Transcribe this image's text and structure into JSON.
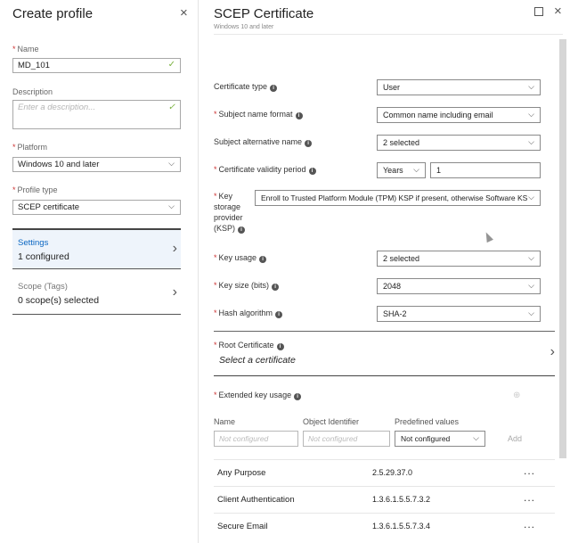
{
  "left_blade": {
    "title": "Create profile",
    "close_glyph": "×",
    "name": {
      "label": "Name",
      "value": "MD_101"
    },
    "description": {
      "label": "Description",
      "placeholder": "Enter a description..."
    },
    "platform": {
      "label": "Platform",
      "value": "Windows 10 and later"
    },
    "profile_type": {
      "label": "Profile type",
      "value": "SCEP certificate"
    },
    "settings": {
      "title": "Settings",
      "status": "1 configured"
    },
    "scope": {
      "title": "Scope (Tags)",
      "status": "0 scope(s) selected"
    }
  },
  "right_blade": {
    "title": "SCEP Certificate",
    "subtitle": "Windows 10 and later",
    "close_glyph": "×",
    "certificate_type": {
      "label": "Certificate type",
      "value": "User"
    },
    "subject_name_format": {
      "label": "Subject name format",
      "value": "Common name including email"
    },
    "subject_alternative_name": {
      "label": "Subject alternative name",
      "value": "2 selected"
    },
    "validity_period": {
      "label": "Certificate validity period",
      "unit": "Years",
      "value": "1"
    },
    "ksp": {
      "label": "Key storage provider (KSP)",
      "value": "Enroll to Trusted Platform Module (TPM) KSP if present, otherwise Software KSP"
    },
    "key_usage": {
      "label": "Key usage",
      "value": "2 selected"
    },
    "key_size": {
      "label": "Key size (bits)",
      "value": "2048"
    },
    "hash_algorithm": {
      "label": "Hash algorithm",
      "value": "SHA-2"
    },
    "root_certificate": {
      "label": "Root Certificate",
      "placeholder": "Select a certificate"
    },
    "extended_key_usage": {
      "label": "Extended key usage",
      "columns": {
        "name": "Name",
        "oid": "Object Identifier",
        "predefined": "Predefined values"
      },
      "name_placeholder": "Not configured",
      "oid_placeholder": "Not configured",
      "predefined_value": "Not configured",
      "add_label": "Add",
      "more_glyph": "...",
      "rows": [
        {
          "name": "Any Purpose",
          "oid": "2.5.29.37.0"
        },
        {
          "name": "Client Authentication",
          "oid": "1.3.6.1.5.5.7.3.2"
        },
        {
          "name": "Secure Email",
          "oid": "1.3.6.1.5.5.7.3.4"
        }
      ]
    }
  },
  "icons": {
    "check": "check-icon",
    "chevron_down": "chevron-down-icon",
    "chevron_right": "chevron-right-icon",
    "info": "info-icon",
    "close": "close-icon",
    "maximize": "maximize-icon",
    "more": "more-icon"
  },
  "colors": {
    "link_blue": "#0a66c2",
    "check_green": "#7cb342",
    "required_red": "#cc3333",
    "selected_nav_bg": "#eef4fb"
  }
}
